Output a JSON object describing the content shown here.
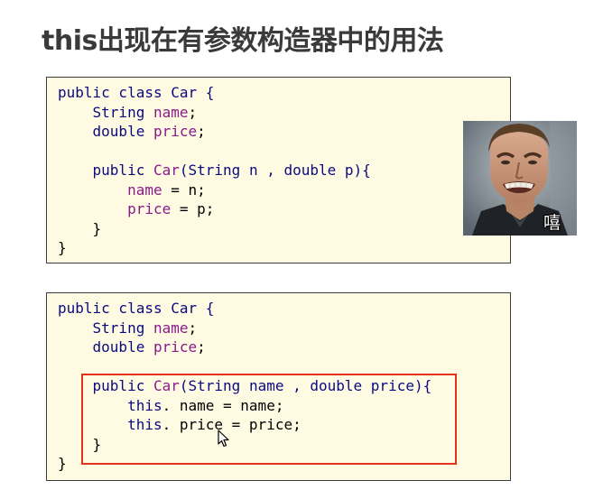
{
  "title": "this出现在有参数构造器中的用法",
  "code_block_1": {
    "lines": [
      [
        {
          "t": "public class Car {",
          "c": "kw0"
        }
      ],
      [
        {
          "t": "    String ",
          "c": "kw"
        },
        {
          "t": "name",
          "c": "fld"
        },
        {
          "t": ";",
          "c": ""
        }
      ],
      [
        {
          "t": "    double ",
          "c": "kw"
        },
        {
          "t": "price",
          "c": "fld"
        },
        {
          "t": ";",
          "c": ""
        }
      ],
      [
        {
          "t": "",
          "c": ""
        }
      ],
      [
        {
          "t": "    public ",
          "c": "kw"
        },
        {
          "t": "Car",
          "c": "fld"
        },
        {
          "t": "(String n , double p){",
          "c": "kw"
        }
      ],
      [
        {
          "t": "        name",
          "c": "fld"
        },
        {
          "t": " = n;",
          "c": ""
        }
      ],
      [
        {
          "t": "        price",
          "c": "fld"
        },
        {
          "t": " = p;",
          "c": ""
        }
      ],
      [
        {
          "t": "    }",
          "c": ""
        }
      ],
      [
        {
          "t": "}",
          "c": ""
        }
      ]
    ]
  },
  "code_block_2": {
    "lines": [
      [
        {
          "t": "public class Car {",
          "c": "kw0"
        }
      ],
      [
        {
          "t": "    String ",
          "c": "kw"
        },
        {
          "t": "name",
          "c": "fld"
        },
        {
          "t": ";",
          "c": ""
        }
      ],
      [
        {
          "t": "    double ",
          "c": "kw"
        },
        {
          "t": "price",
          "c": "fld"
        },
        {
          "t": ";",
          "c": ""
        }
      ],
      [
        {
          "t": "",
          "c": ""
        }
      ],
      [
        {
          "t": "    public ",
          "c": "kw"
        },
        {
          "t": "Car",
          "c": "fld"
        },
        {
          "t": "(String name , double price){",
          "c": "kw"
        }
      ],
      [
        {
          "t": "        this",
          "c": "kw"
        },
        {
          "t": ". name = name;",
          "c": ""
        }
      ],
      [
        {
          "t": "        this",
          "c": "kw"
        },
        {
          "t": ". price = price;",
          "c": ""
        }
      ],
      [
        {
          "t": "    }",
          "c": ""
        }
      ],
      [
        {
          "t": "}",
          "c": ""
        }
      ]
    ]
  },
  "meme": {
    "caption": "嘻"
  },
  "colors": {
    "code_background": "#fffbe3",
    "highlight_border": "#e8301c",
    "keyword": "#0a0a80",
    "field": "#8a1a8a"
  },
  "icons": {
    "cursor": "mouse-pointer-icon"
  }
}
